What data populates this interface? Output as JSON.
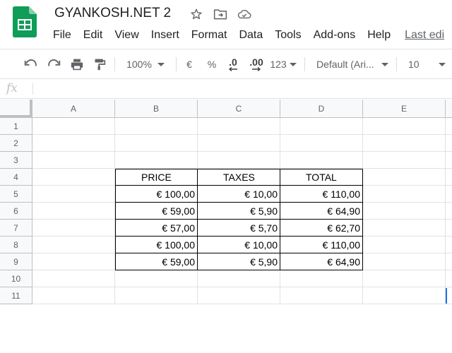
{
  "app": {
    "doc_title": "GYANKOSH.NET 2",
    "colors": {
      "accent": "#1a73e8",
      "sheets_green": "#0f9d58",
      "grid_line": "#e2e2e2"
    }
  },
  "header": {
    "icons": [
      "star-icon",
      "move-to-folder-icon",
      "cloud-saved-icon"
    ]
  },
  "menu": {
    "items": [
      "File",
      "Edit",
      "View",
      "Insert",
      "Format",
      "Data",
      "Tools",
      "Add-ons",
      "Help"
    ],
    "last_edit": "Last edi"
  },
  "toolbar": {
    "zoom": "100%",
    "currency": "€",
    "percent": "%",
    "decrease_decimals": ".0",
    "increase_decimals": ".00",
    "more_formats": "123",
    "font": "Default (Ari...",
    "font_size": "10"
  },
  "formula_bar": {
    "label": "fx",
    "value": ""
  },
  "grid": {
    "columns": [
      "A",
      "B",
      "C",
      "D",
      "E"
    ],
    "rows": [
      "1",
      "2",
      "3",
      "4",
      "5",
      "6",
      "7",
      "8",
      "9",
      "10",
      "11"
    ],
    "table": {
      "headers": [
        "PRICE",
        "TAXES",
        "TOTAL"
      ],
      "rows": [
        [
          "€ 100,00",
          "€ 10,00",
          "€ 110,00"
        ],
        [
          "€ 59,00",
          "€ 5,90",
          "€ 64,90"
        ],
        [
          "€ 57,00",
          "€ 5,70",
          "€ 62,70"
        ],
        [
          "€ 100,00",
          "€ 10,00",
          "€ 110,00"
        ],
        [
          "€ 59,00",
          "€ 5,90",
          "€ 64,90"
        ]
      ]
    }
  }
}
